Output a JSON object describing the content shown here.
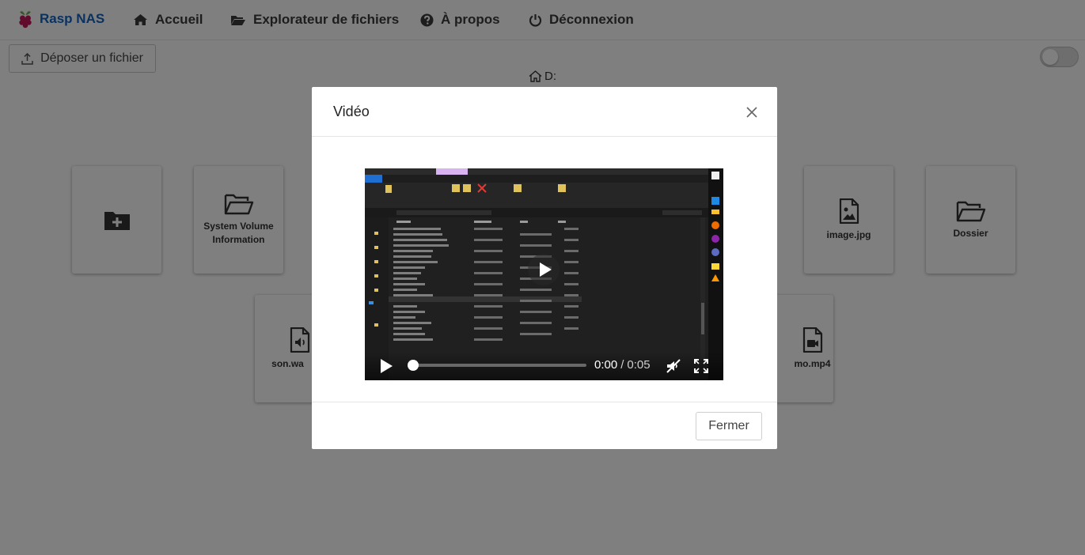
{
  "brand": {
    "name": "Rasp NAS",
    "color": "#1565c0",
    "icon": "raspberry-pi-icon"
  },
  "nav": {
    "items": [
      {
        "label": "Accueil",
        "icon": "home-icon"
      },
      {
        "label": "Explorateur de fichiers",
        "icon": "folder-open-icon"
      },
      {
        "label": "À propos",
        "icon": "question-circle-icon"
      },
      {
        "label": "Déconnexion",
        "icon": "power-icon"
      }
    ]
  },
  "toolbar": {
    "upload_label": "Déposer un fichier",
    "upload_icon": "upload-icon",
    "toggle_on": false
  },
  "breadcrumb": {
    "label": "D:",
    "icon": "home-outline-icon"
  },
  "files": [
    {
      "label": "",
      "icon": "new-folder-icon"
    },
    {
      "label": "System Volume Information",
      "icon": "folder-icon"
    },
    {
      "label": "image.jpg",
      "icon": "image-file-icon"
    },
    {
      "label": "Dossier",
      "icon": "folder-icon"
    },
    {
      "label": "son.wa",
      "icon": "audio-file-icon"
    },
    {
      "label": "mo.mp4",
      "icon": "video-file-icon"
    }
  ],
  "modal": {
    "title": "Vidéo",
    "close_icon": "close-icon",
    "close_button_label": "Fermer",
    "video": {
      "current_time": "0:00",
      "separator": "/",
      "duration": "0:05",
      "progress": 0.0,
      "muted": true
    }
  }
}
